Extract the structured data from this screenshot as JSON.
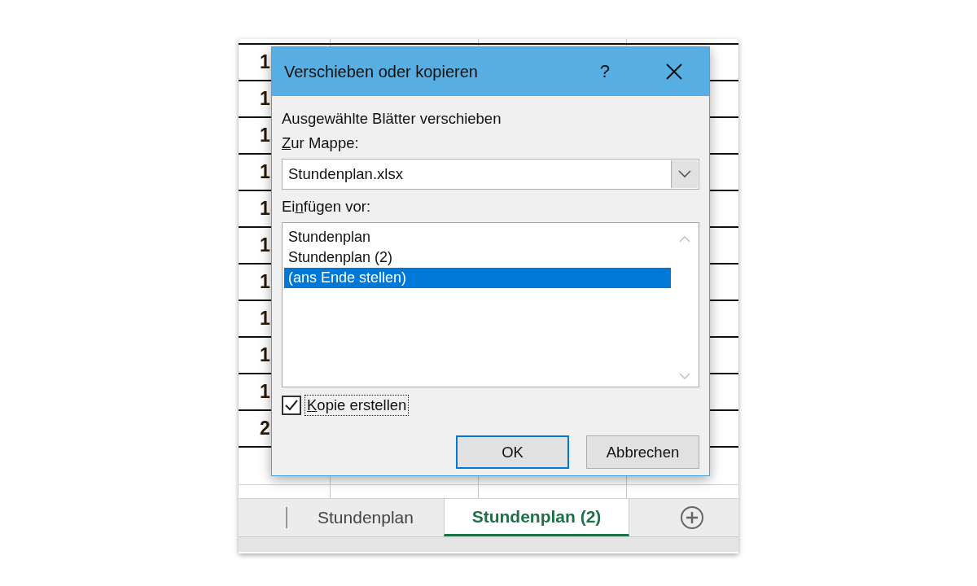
{
  "sheet": {
    "rows": [
      {
        "column_1": "1"
      },
      {
        "column_1": "1"
      },
      {
        "column_1": "1"
      },
      {
        "column_1": "1"
      },
      {
        "column_1": "1"
      },
      {
        "column_1": "1"
      },
      {
        "column_1": "1"
      },
      {
        "column_1": "1"
      },
      {
        "column_1": "1"
      },
      {
        "column_1": "1"
      },
      {
        "column_1": "2"
      }
    ]
  },
  "sheet_tabs": [
    {
      "label": "Stundenplan",
      "selected": false
    },
    {
      "label": "Stundenplan (2)",
      "selected": true
    }
  ],
  "dialog": {
    "title": "Verschieben oder kopieren",
    "help": "?",
    "heading": "Ausgewählte Blätter verschieben",
    "workbook_label": {
      "access_key": "Z",
      "text_after": "ur Mappe:"
    },
    "workbook_select": {
      "value": "Stundenplan.xlsx"
    },
    "insert_before_label": {
      "text_before": "Ei",
      "access_key": "n",
      "text_after": "fügen vor:"
    },
    "insert_before_list": [
      {
        "label": "Stundenplan",
        "selected": false
      },
      {
        "label": "Stundenplan (2)",
        "selected": false
      },
      {
        "label": "(ans Ende stellen)",
        "selected": true
      }
    ],
    "copy_checkbox": {
      "access_key": "K",
      "text_after": "opie erstellen",
      "checked": true,
      "focused": true
    },
    "buttons": [
      {
        "label": "OK",
        "default": true
      },
      {
        "label": "Abbrechen",
        "default": false
      }
    ]
  }
}
